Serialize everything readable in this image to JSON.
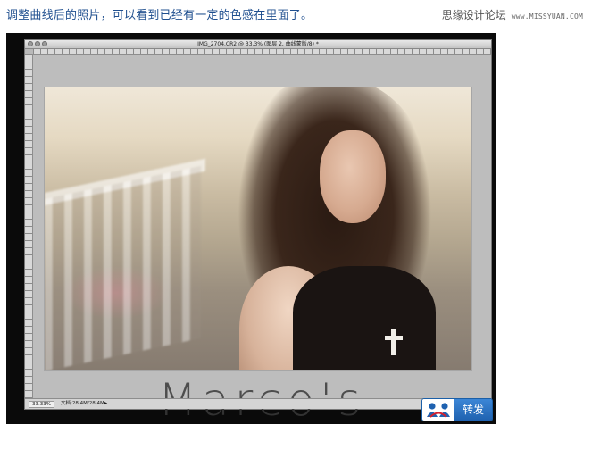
{
  "header": {
    "caption": "调整曲线后的照片，可以看到已经有一定的色感在里面了。",
    "site_name": "思缘设计论坛",
    "site_url": "www.MISSYUAN.COM"
  },
  "photoshop": {
    "document_title": "IMG_2704.CR2 @ 33.3% (图层 2, 曲线蒙版/8) *",
    "status_zoom": "33.33%",
    "status_doc": "文档:28.4M/28.4M"
  },
  "photo": {
    "watermark_text": "Marco's"
  },
  "share": {
    "label": "转发",
    "logo_icon": "people-logo-icon"
  },
  "colors": {
    "caption": "#1f4f8f",
    "share_blue": "#1f62b0"
  }
}
